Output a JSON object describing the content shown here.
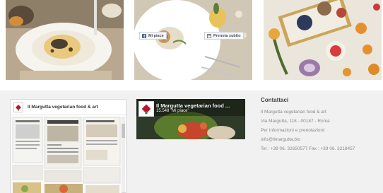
{
  "photos": [
    {
      "subject": "pasta-with-truffle-dish"
    },
    {
      "subject": "plated-dish-with-cutlery"
    },
    {
      "subject": "food-tray-flatlay"
    }
  ],
  "facebook_box": {
    "title": "Il Margutta vegetarian food & art"
  },
  "facebook_plugin": {
    "title": "Il Margutta vegetarian food ...",
    "likes": "15.548 \"Mi piace\"",
    "like_button": "Mi piace",
    "book_button": "Prenota subito"
  },
  "contacts": {
    "heading": "Contattaci",
    "name": "Il Margutta vegetarian food & art",
    "address": "Via Margutta, 118 - 00187 - Roma",
    "info_label": "Per informazioni e prenotazioni:",
    "email": "info@ilmargutta.bio",
    "phone": "Tel : +39 06. 32650577 Fax : +39 06. 3218457"
  },
  "colors": {
    "facebook_blue": "#3b5998",
    "lower_section_bg": "#f1f1f1",
    "contact_text": "#8a8a8a",
    "logo_red": "#b5182b"
  }
}
